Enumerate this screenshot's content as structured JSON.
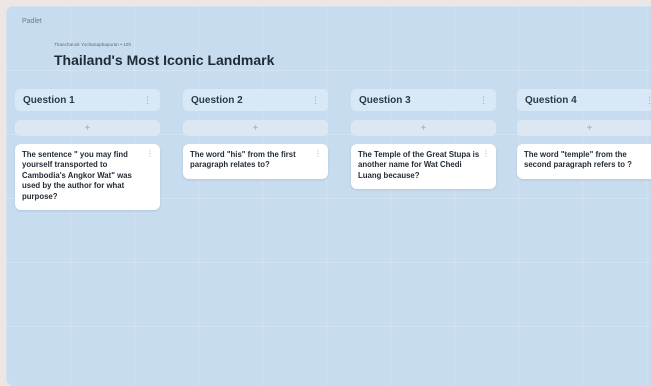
{
  "app": {
    "brand": "Padlet",
    "byline": "Thanchanok Yochanapbapuran • 10h",
    "title": "Thailand's Most Iconic Landmark"
  },
  "columns": [
    {
      "title": "Question 1",
      "menu_icon": "more-vertical-icon",
      "add_label": "+",
      "card": "The sentence \" you may find yourself transported to Cambodia's Angkor Wat\" was used by the author for what purpose?"
    },
    {
      "title": "Question 2",
      "menu_icon": "more-vertical-icon",
      "add_label": "+",
      "card": "The word \"his\" from the first paragraph relates to?"
    },
    {
      "title": "Question 3",
      "menu_icon": "more-vertical-icon",
      "add_label": "+",
      "card": "The Temple of the Great Stupa is another name for Wat Chedi Luang because?"
    },
    {
      "title": "Question 4",
      "menu_icon": "more-vertical-icon",
      "add_label": "+",
      "card": "The word \"temple\" from the second paragraph refers to ?"
    }
  ],
  "colors": {
    "board_bg": "#c7dcef",
    "header_bg": "#d9e8f6",
    "card_bg": "#ffffff"
  }
}
